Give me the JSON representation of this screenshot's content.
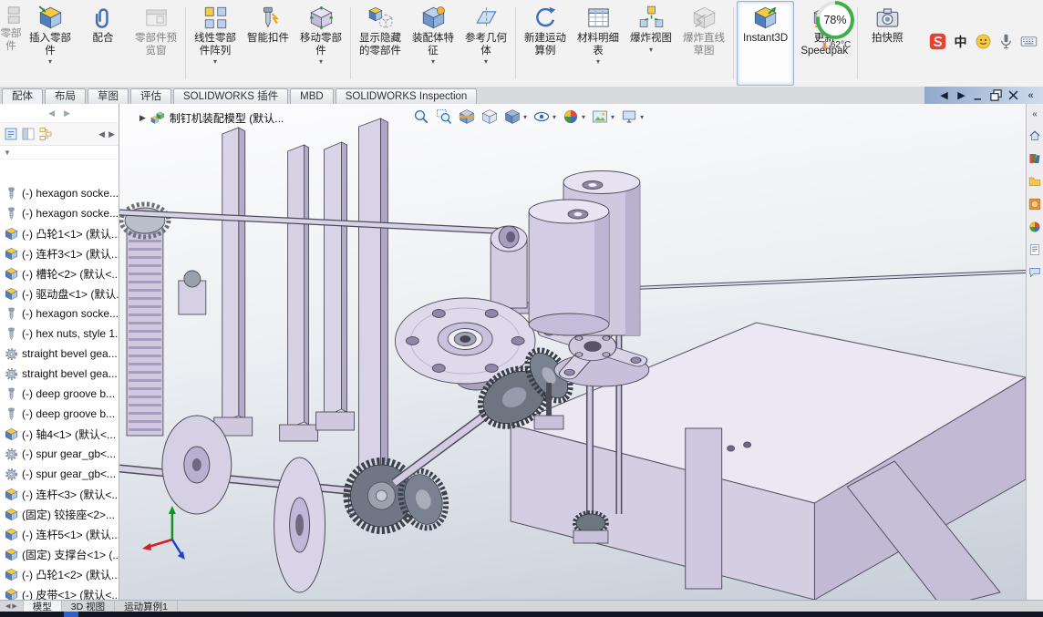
{
  "ribbon": {
    "clipped_button_label": "零部件",
    "buttons": [
      {
        "id": "insert-component",
        "label": "插入零部件",
        "icon": "insert-component-icon",
        "dropdown": true
      },
      {
        "id": "mate",
        "label": "配合",
        "icon": "mate-icon"
      },
      {
        "id": "component-preview-window",
        "label": "零部件预览窗",
        "icon": "preview-window-icon",
        "disabled": true
      },
      {
        "sep": true
      },
      {
        "id": "linear-component-pattern",
        "label": "线性零部件阵列",
        "icon": "linear-pattern-icon",
        "dropdown": true
      },
      {
        "id": "smart-fasteners",
        "label": "智能扣件",
        "icon": "smart-fastener-icon"
      },
      {
        "id": "move-component",
        "label": "移动零部件",
        "icon": "move-component-icon",
        "dropdown": true
      },
      {
        "sep": true
      },
      {
        "id": "show-hidden-components",
        "label": "显示隐藏的零部件",
        "icon": "show-hidden-icon"
      },
      {
        "id": "assembly-features",
        "label": "装配体特征",
        "icon": "assembly-feature-icon",
        "dropdown": true
      },
      {
        "id": "reference-geometry",
        "label": "参考几何体",
        "icon": "reference-geometry-icon",
        "dropdown": true
      },
      {
        "sep": true
      },
      {
        "id": "new-motion-study",
        "label": "新建运动算例",
        "icon": "motion-study-icon"
      },
      {
        "id": "bill-of-materials",
        "label": "材料明细表",
        "icon": "bom-icon",
        "dropdown": true
      },
      {
        "id": "exploded-view",
        "label": "爆炸视图",
        "icon": "exploded-view-icon",
        "dropdown": true
      },
      {
        "id": "explode-line-sketch",
        "label": "爆炸直线草图",
        "icon": "explode-sketch-icon",
        "disabled": true
      },
      {
        "sep": true
      },
      {
        "id": "instant3d",
        "label": "Instant3D",
        "icon": "instant3d-icon",
        "selected": true
      },
      {
        "id": "update-speedpak",
        "label": "更新 Speedpak",
        "icon": "speedpak-icon"
      },
      {
        "sep": true
      },
      {
        "id": "take-snapshot",
        "label": "拍快照",
        "icon": "snapshot-icon"
      }
    ]
  },
  "system_gauge": {
    "percent_text": "78%",
    "percent_value": 78,
    "temperature": "62°C"
  },
  "tray": {
    "icons": [
      {
        "name": "sogou-icon"
      },
      {
        "name": "lang-zh-icon",
        "label": "中"
      },
      {
        "name": "smiley-icon"
      },
      {
        "name": "mic-icon"
      },
      {
        "name": "keyboard-icon"
      }
    ]
  },
  "command_tabs": {
    "tabs": [
      {
        "label": "配体",
        "active": true
      },
      {
        "label": "布局"
      },
      {
        "label": "草图"
      },
      {
        "label": "评估"
      },
      {
        "label": "SOLIDWORKS 插件"
      },
      {
        "label": "MBD"
      },
      {
        "label": "SOLIDWORKS Inspection"
      }
    ],
    "window_controls": [
      "back-icon",
      "forward-icon",
      "minimize-icon",
      "restore-icon",
      "close-icon",
      "collapse-panel-icon"
    ]
  },
  "feature_tree": {
    "panel_tabs": [
      "featuremanager-tree-icon",
      "display-pane-icon",
      "configurations-icon"
    ],
    "items": [
      {
        "label": "(-) hexagon socke...",
        "icon": "screw-icon"
      },
      {
        "label": "(-) hexagon socke...",
        "icon": "screw-icon"
      },
      {
        "label": "(-) 凸轮1<1> (默认...",
        "icon": "part-icon"
      },
      {
        "label": "(-) 连杆3<1> (默认...",
        "icon": "part-icon"
      },
      {
        "label": "(-) 槽轮<2> (默认<...",
        "icon": "part-icon"
      },
      {
        "label": "(-) 驱动盘<1> (默认...",
        "icon": "part-icon"
      },
      {
        "label": "(-) hexagon socke...",
        "icon": "screw-icon"
      },
      {
        "label": "(-) hex nuts, style 1...",
        "icon": "screw-icon"
      },
      {
        "label": "straight bevel gea...",
        "icon": "gear-icon"
      },
      {
        "label": "straight bevel gea...",
        "icon": "gear-icon"
      },
      {
        "label": "(-) deep groove b...",
        "icon": "screw-icon"
      },
      {
        "label": "(-) deep groove b...",
        "icon": "screw-icon"
      },
      {
        "label": "(-) 轴4<1> (默认<...",
        "icon": "part-icon"
      },
      {
        "label": "(-) spur gear_gb<...",
        "icon": "gear-icon"
      },
      {
        "label": "(-) spur gear_gb<...",
        "icon": "gear-icon"
      },
      {
        "label": "(-) 连杆<3> (默认<...",
        "icon": "part-icon"
      },
      {
        "label": "(固定) 铰接座<2>...",
        "icon": "part-icon"
      },
      {
        "label": "(-) 连杆5<1> (默认...",
        "icon": "part-icon"
      },
      {
        "label": "(固定) 支撑台<1> (...",
        "icon": "part-icon"
      },
      {
        "label": "(-) 凸轮1<2> (默认...",
        "icon": "part-icon"
      },
      {
        "label": "(-) 皮带<1> (默认<...",
        "icon": "part-icon"
      }
    ]
  },
  "viewport": {
    "breadcrumb": "制钉机装配模型 (默认..."
  },
  "hud_toolbar": {
    "icons": [
      {
        "name": "zoom-fit-icon"
      },
      {
        "name": "zoom-area-icon"
      },
      {
        "name": "section-view-icon"
      },
      {
        "name": "view-orientation-icon"
      },
      {
        "name": "display-style-icon",
        "dropdown": true
      },
      {
        "name": "hide-show-items-icon",
        "dropdown": true
      },
      {
        "name": "edit-appearance-icon",
        "dropdown": true
      },
      {
        "name": "apply-scene-icon",
        "dropdown": true
      },
      {
        "name": "view-settings-icon",
        "dropdown": true
      }
    ]
  },
  "task_pane": {
    "icons": [
      "solidworks-resources-icon",
      "design-library-icon",
      "file-explorer-icon",
      "appearances-icon",
      "scenes-icon",
      "custom-properties-icon",
      "forum-icon"
    ]
  },
  "bottom_bar": {
    "tabs": [
      {
        "label": "模型",
        "active": true
      },
      {
        "label": "3D 视图"
      },
      {
        "label": "运动算例1"
      }
    ]
  }
}
